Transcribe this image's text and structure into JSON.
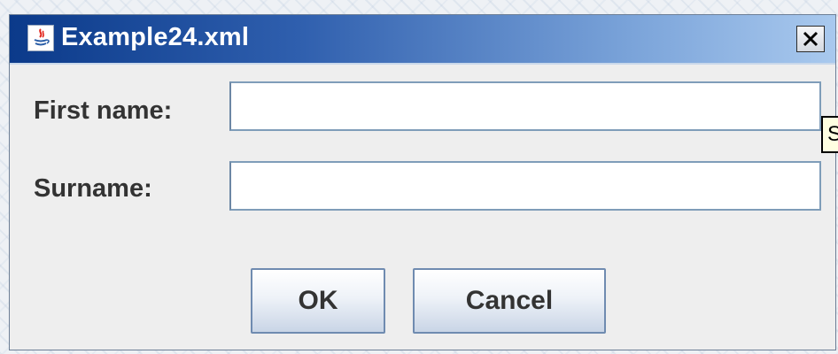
{
  "window": {
    "title": "Example24.xml"
  },
  "form": {
    "first_name_label": "First name:",
    "surname_label": "Surname:",
    "first_name_value": "",
    "surname_value": ""
  },
  "tooltip": {
    "text": "S"
  },
  "buttons": {
    "ok_label": "OK",
    "cancel_label": "Cancel"
  },
  "icons": {
    "app": "java-icon",
    "close": "close-icon"
  },
  "colors": {
    "titlebar_start": "#0b3a8a",
    "titlebar_end": "#a9c9ee",
    "window_bg": "#eeeeee",
    "tooltip_bg": "#ffffe1"
  }
}
